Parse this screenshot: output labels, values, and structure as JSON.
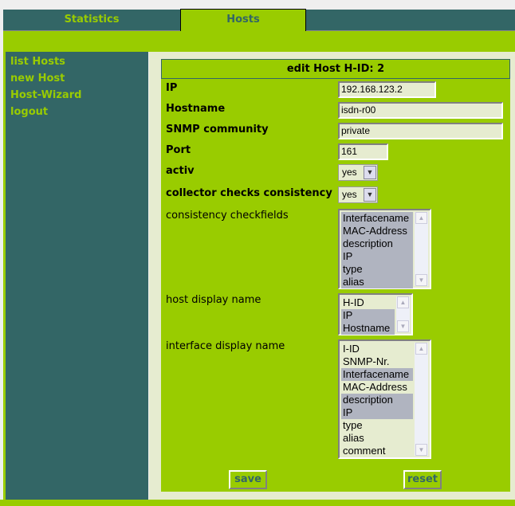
{
  "tabs": [
    {
      "label": "Statistics"
    },
    {
      "label": "Hosts",
      "active": true
    }
  ],
  "sidebar": {
    "items": [
      {
        "label": "list Hosts"
      },
      {
        "label": "new Host"
      },
      {
        "label": "Host-Wizard"
      },
      {
        "label": "logout"
      }
    ]
  },
  "form": {
    "title": "edit Host H-ID: 2",
    "ip": {
      "label": "IP",
      "value": "192.168.123.2"
    },
    "hostname": {
      "label": "Hostname",
      "value": "isdn-r00"
    },
    "snmp": {
      "label": "SNMP community",
      "value": "private"
    },
    "port": {
      "label": "Port",
      "value": "161"
    },
    "activ": {
      "label": "activ",
      "value": "yes"
    },
    "collector": {
      "label": "collector checks consistency",
      "value": "yes"
    },
    "checkfields": {
      "label": "consistency checkfields",
      "options": [
        {
          "text": "Interfacename",
          "selected": true
        },
        {
          "text": "MAC-Address",
          "selected": true
        },
        {
          "text": "description",
          "selected": true
        },
        {
          "text": "IP",
          "selected": true
        },
        {
          "text": "type",
          "selected": true
        },
        {
          "text": "alias",
          "selected": true
        }
      ]
    },
    "hostdisplay": {
      "label": "host display name",
      "options": [
        {
          "text": "H-ID",
          "selected": false
        },
        {
          "text": "IP",
          "selected": true
        },
        {
          "text": "Hostname",
          "selected": true
        }
      ]
    },
    "ifdisplay": {
      "label": "interface display name",
      "options": [
        {
          "text": "I-ID",
          "selected": false
        },
        {
          "text": "SNMP-Nr.",
          "selected": false
        },
        {
          "text": "Interfacename",
          "selected": true
        },
        {
          "text": "MAC-Address",
          "selected": false
        },
        {
          "text": "description",
          "selected": true
        },
        {
          "text": "IP",
          "selected": true
        },
        {
          "text": "type",
          "selected": false
        },
        {
          "text": "alias",
          "selected": false
        },
        {
          "text": "comment",
          "selected": false
        }
      ]
    },
    "save_label": "save",
    "reset_label": "reset"
  },
  "colors": {
    "teal": "#336666",
    "green": "#99cc00",
    "light": "#e6ecd0",
    "selected": "#b0b4c0"
  }
}
